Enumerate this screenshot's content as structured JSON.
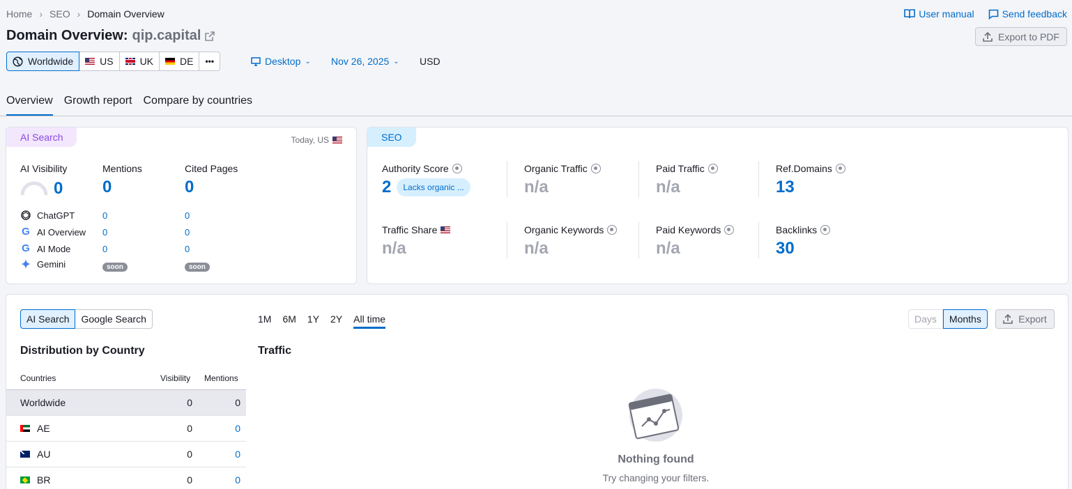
{
  "breadcrumb": [
    "Home",
    "SEO",
    "Domain Overview"
  ],
  "header": {
    "user_manual": "User manual",
    "send_feedback": "Send feedback",
    "title_prefix": "Domain Overview:",
    "domain": "qip.capital",
    "export_pdf": "Export to PDF"
  },
  "db": {
    "worldwide": "Worldwide",
    "us": "US",
    "uk": "UK",
    "de": "DE",
    "more": "•••"
  },
  "filters": {
    "device": "Desktop",
    "date": "Nov 26, 2025",
    "currency": "USD"
  },
  "tabs": [
    "Overview",
    "Growth report",
    "Compare by countries"
  ],
  "ai_card": {
    "badge": "AI Search",
    "scope": "Today, US",
    "visibility_label": "AI Visibility",
    "visibility": "0",
    "mentions_label": "Mentions",
    "mentions": "0",
    "cited_label": "Cited Pages",
    "cited": "0",
    "rows": [
      {
        "name": "ChatGPT",
        "mentions": "0",
        "cited": "0"
      },
      {
        "name": "AI Overview",
        "mentions": "0",
        "cited": "0"
      },
      {
        "name": "AI Mode",
        "mentions": "0",
        "cited": "0"
      },
      {
        "name": "Gemini",
        "mentions": "soon",
        "cited": "soon"
      }
    ]
  },
  "seo_card": {
    "badge": "SEO",
    "authority_label": "Authority Score",
    "authority": "2",
    "authority_tag": "Lacks organic ...",
    "organic_traffic_label": "Organic Traffic",
    "organic_traffic": "n/a",
    "paid_traffic_label": "Paid Traffic",
    "paid_traffic": "n/a",
    "ref_domains_label": "Ref.Domains",
    "ref_domains": "13",
    "traffic_share_label": "Traffic Share",
    "traffic_share": "n/a",
    "organic_kw_label": "Organic Keywords",
    "organic_kw": "n/a",
    "paid_kw_label": "Paid Keywords",
    "paid_kw": "n/a",
    "backlinks_label": "Backlinks",
    "backlinks": "30"
  },
  "bottom": {
    "seg_ai": "AI Search",
    "seg_google": "Google Search",
    "ranges": [
      "1M",
      "6M",
      "1Y",
      "2Y",
      "All time"
    ],
    "days": "Days",
    "months": "Months",
    "export": "Export",
    "dist_title": "Distribution by Country",
    "traffic_title": "Traffic",
    "col_countries": "Countries",
    "col_visibility": "Visibility",
    "col_mentions": "Mentions",
    "rows": [
      {
        "country": "Worldwide",
        "visibility": "0",
        "mentions": "0"
      },
      {
        "country": "AE",
        "visibility": "0",
        "mentions": "0"
      },
      {
        "country": "AU",
        "visibility": "0",
        "mentions": "0"
      },
      {
        "country": "BR",
        "visibility": "0",
        "mentions": "0"
      }
    ],
    "empty_title": "Nothing found",
    "empty_sub": "Try changing your filters."
  },
  "colors": {
    "accent": "#006dca",
    "ai_badge_bg": "#f3e7fd",
    "seo_badge_bg": "#d6efff",
    "muted": "#a4a6b1"
  }
}
